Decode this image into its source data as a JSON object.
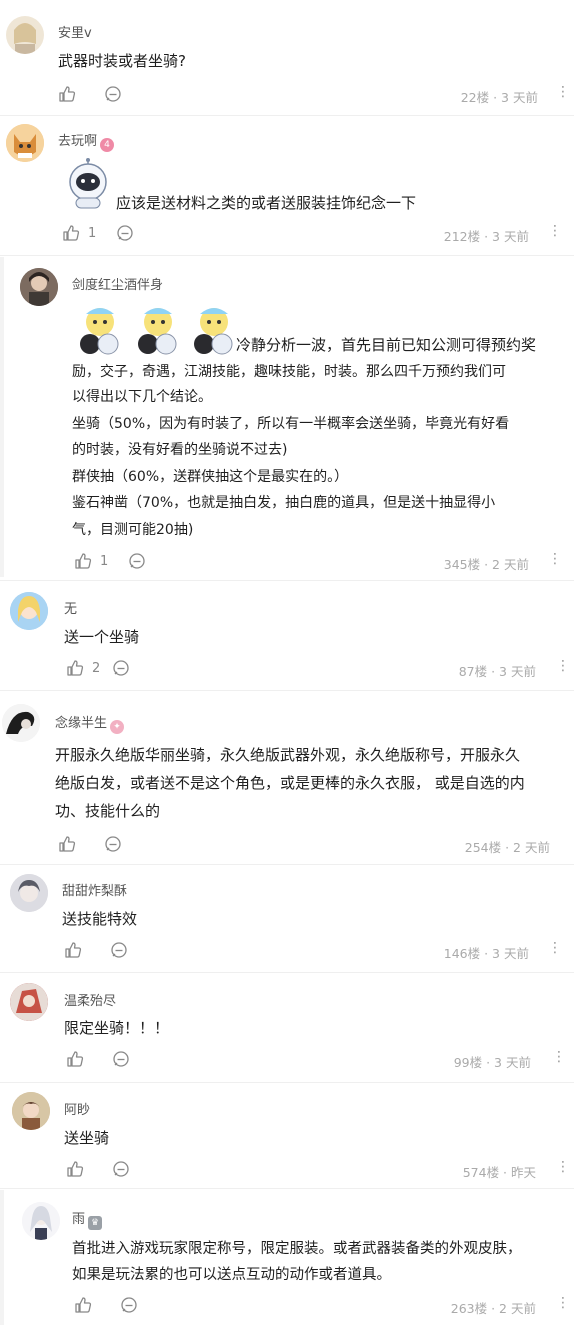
{
  "comments": [
    {
      "user": "安里v",
      "text": "武器时装或者坐骑?",
      "likes": "",
      "floor": "22楼 · 3 天前"
    },
    {
      "user": "去玩啊",
      "text": "应该是送材料之类的或者送服装挂饰纪念一下",
      "likes": "1",
      "floor": "212楼 · 3 天前"
    },
    {
      "user": "剑度红尘酒伴身",
      "text_lines": [
        "冷静分析一波，首先目前已知公测可得预约奖",
        "励，交子，奇遇，江湖技能，趣味技能，时装。那么四千万预约我们可",
        "以得出以下几个结论。",
        "坐骑（50%，因为有时装了，所以有一半概率会送坐骑，毕竟光有好看",
        "的时装，没有好看的坐骑说不过去)",
        "群侠抽（60%，送群侠抽这个是最实在的。）",
        "鉴石神凿（70%，也就是抽白发，抽白鹿的道具，但是送十抽显得小",
        "气，目测可能20抽)"
      ],
      "likes": "1",
      "floor": "345楼 · 2 天前"
    },
    {
      "user": "无",
      "text": "送一个坐骑",
      "likes": "2",
      "floor": "87楼 · 3 天前"
    },
    {
      "user": "念缘半生",
      "text_lines": [
        "开服永久绝版华丽坐骑，永久绝版武器外观，永久绝版称号，开服永久",
        "绝版白发，或者送不是这个角色，或是更棒的永久衣服， 或是自选的内",
        "功、技能什么的"
      ],
      "likes": "",
      "floor": "254楼 · 2 天前"
    },
    {
      "user": "甜甜炸梨酥",
      "text": "送技能特效",
      "likes": "",
      "floor": "146楼 · 3 天前"
    },
    {
      "user": "温柔殆尽",
      "text": "限定坐骑！！！",
      "likes": "",
      "floor": "99楼 · 3 天前"
    },
    {
      "user": "阿眇",
      "text": "送坐骑",
      "likes": "",
      "floor": "574楼 · 昨天"
    },
    {
      "user": "雨",
      "text_lines": [
        "首批进入游戏玩家限定称号，限定服装。或者武器装备类的外观皮肤，",
        "如果是玩法累的也可以送点互动的动作或者道具。"
      ],
      "likes": "",
      "floor": "263楼 · 2 天前"
    }
  ],
  "icons": {
    "like": "thumbs-up-icon",
    "reply": "reply-bubble-icon",
    "more": "more-vertical-icon"
  },
  "colors": {
    "badge_orange": "#ef8aa6",
    "meta": "#aaaaaa",
    "text": "#1f1f1f"
  }
}
